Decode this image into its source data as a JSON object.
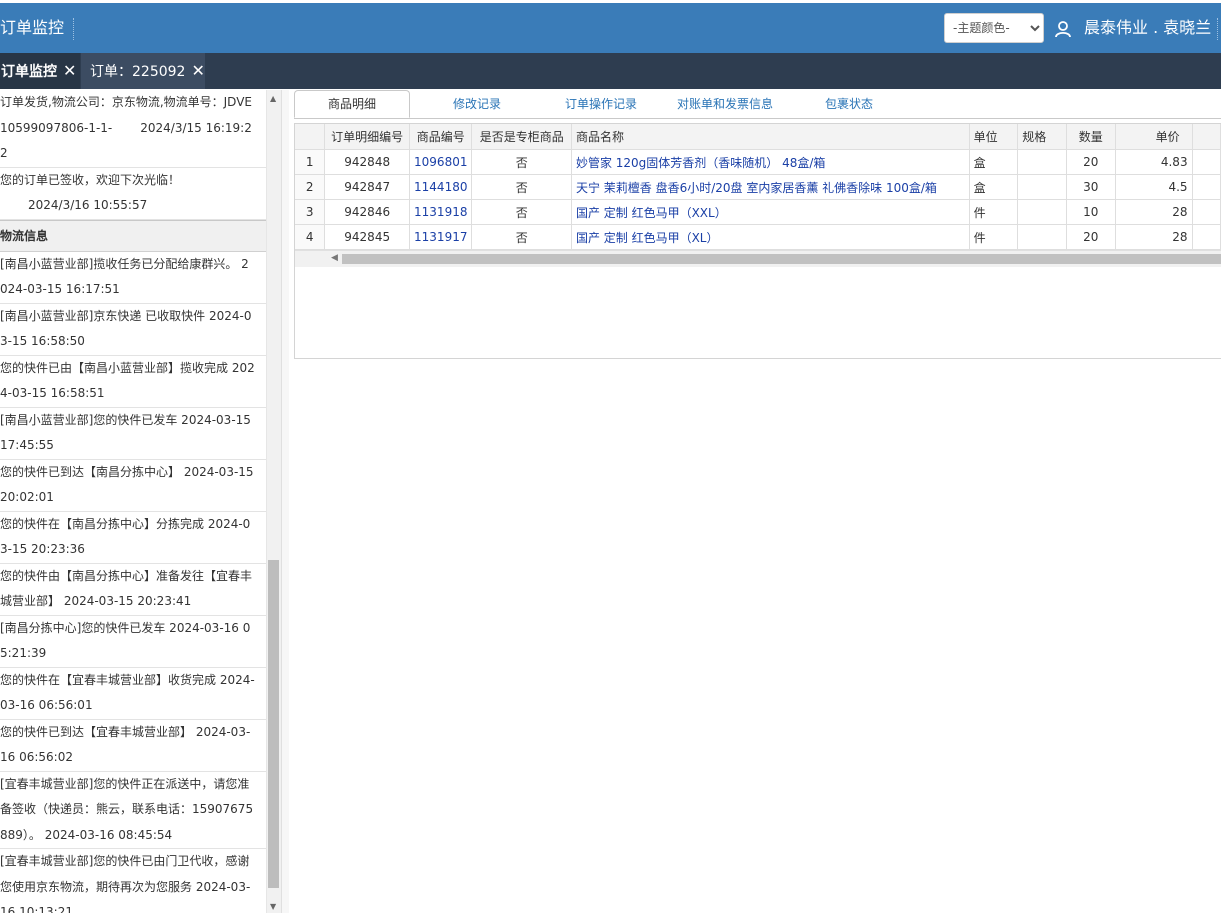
{
  "header": {
    "title": "订单监控",
    "theme_select": {
      "selected": "-主题颜色-",
      "options": [
        "-主题颜色-"
      ]
    },
    "user_name": "晨泰伟业 . 袁晓兰"
  },
  "tabs": [
    {
      "label": "订单监控"
    },
    {
      "label": "订单：225092"
    }
  ],
  "left_panel": {
    "order_status": [
      {
        "text": "订单发货,物流公司：京东物流,物流单号：JDVE10599097806-1-1-",
        "date": "2024/3/15 16:19:22"
      },
      {
        "text": "您的订单已签收，欢迎下次光临！",
        "date": "2024/3/16 10:55:57"
      }
    ],
    "logistics_header": "物流信息",
    "logistics": [
      "[南昌小蓝营业部]揽收任务已分配给康群兴。 2024-03-15 16:17:51",
      "[南昌小蓝营业部]京东快递 已收取快件 2024-03-15 16:58:50",
      "您的快件已由【南昌小蓝营业部】揽收完成 2024-03-15 16:58:51",
      "[南昌小蓝营业部]您的快件已发车 2024-03-15 17:45:55",
      "您的快件已到达【南昌分拣中心】 2024-03-15 20:02:01",
      "您的快件在【南昌分拣中心】分拣完成 2024-03-15 20:23:36",
      "您的快件由【南昌分拣中心】准备发往【宜春丰城营业部】 2024-03-15 20:23:41",
      "[南昌分拣中心]您的快件已发车 2024-03-16 05:21:39",
      "您的快件在【宜春丰城营业部】收货完成 2024-03-16 06:56:01",
      "您的快件已到达【宜春丰城营业部】 2024-03-16 06:56:02",
      "[宜春丰城营业部]您的快件正在派送中，请您准备签收（快递员：熊云，联系电话：15907675889）。 2024-03-16 08:45:54",
      "[宜春丰城营业部]您的快件已由门卫代收，感谢您使用京东物流，期待再次为您服务 2024-03-16 10:13:21"
    ]
  },
  "subtabs": [
    {
      "label": "商品明细"
    },
    {
      "label": "修改记录"
    },
    {
      "label": "订单操作记录"
    },
    {
      "label": "对账单和发票信息"
    },
    {
      "label": "包裹状态"
    }
  ],
  "grid": {
    "columns": [
      "订单明细编号",
      "商品编号",
      "是否是专柜商品",
      "商品名称",
      "单位",
      "规格",
      "数量",
      "单价"
    ],
    "rows": [
      {
        "no": "1",
        "detail_id": "942848",
        "product_id": "1096801",
        "counter": "否",
        "name": "妙管家 120g固体芳香剂（香味随机） 48盒/箱",
        "unit": "盒",
        "spec": "",
        "qty": "20",
        "price": "4.83"
      },
      {
        "no": "2",
        "detail_id": "942847",
        "product_id": "1144180",
        "counter": "否",
        "name": "天宁 茉莉檀香 盘香6小时/20盘 室内家居香薰 礼佛香除味 100盒/箱",
        "unit": "盒",
        "spec": "",
        "qty": "30",
        "price": "4.5"
      },
      {
        "no": "3",
        "detail_id": "942846",
        "product_id": "1131918",
        "counter": "否",
        "name": "国产 定制 红色马甲（XXL）",
        "unit": "件",
        "spec": "",
        "qty": "10",
        "price": "28"
      },
      {
        "no": "4",
        "detail_id": "942845",
        "product_id": "1131917",
        "counter": "否",
        "name": "国产 定制 红色马甲（XL）",
        "unit": "件",
        "spec": "",
        "qty": "20",
        "price": "28"
      }
    ]
  }
}
